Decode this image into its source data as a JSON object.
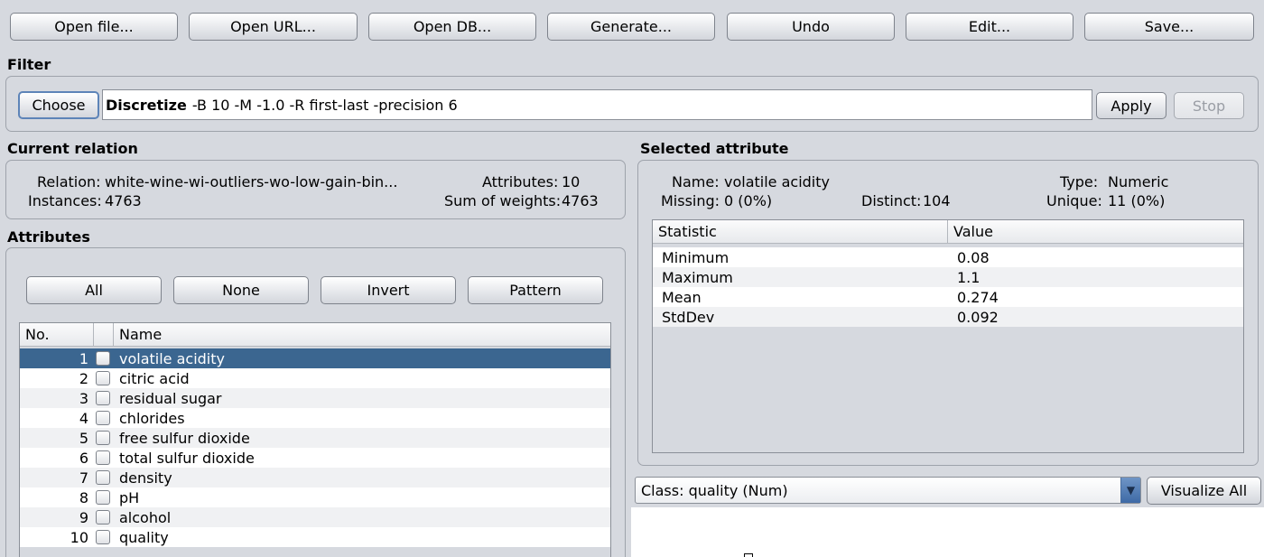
{
  "toolbar": {
    "open_file": "Open file...",
    "open_url": "Open URL...",
    "open_db": "Open DB...",
    "generate": "Generate...",
    "undo": "Undo",
    "edit": "Edit...",
    "save": "Save..."
  },
  "filter": {
    "section_label": "Filter",
    "choose_label": "Choose",
    "filter_name": "Discretize",
    "filter_options": "-B 10 -M -1.0 -R first-last -precision 6",
    "apply_label": "Apply",
    "stop_label": "Stop"
  },
  "current_relation": {
    "section_label": "Current relation",
    "relation_label": "Relation:",
    "relation_value": "white-wine-wi-outliers-wo-low-gain-bin...",
    "instances_label": "Instances:",
    "instances_value": "4763",
    "attributes_label": "Attributes:",
    "attributes_value": "10",
    "sum_weights_label": "Sum of weights:",
    "sum_weights_value": "4763"
  },
  "attributes": {
    "section_label": "Attributes",
    "all_label": "All",
    "none_label": "None",
    "invert_label": "Invert",
    "pattern_label": "Pattern",
    "col_no": "No.",
    "col_name": "Name",
    "rows": [
      {
        "no": "1",
        "name": "volatile acidity"
      },
      {
        "no": "2",
        "name": "citric acid"
      },
      {
        "no": "3",
        "name": "residual sugar"
      },
      {
        "no": "4",
        "name": "chlorides"
      },
      {
        "no": "5",
        "name": "free sulfur dioxide"
      },
      {
        "no": "6",
        "name": "total sulfur dioxide"
      },
      {
        "no": "7",
        "name": "density"
      },
      {
        "no": "8",
        "name": "pH"
      },
      {
        "no": "9",
        "name": "alcohol"
      },
      {
        "no": "10",
        "name": "quality"
      }
    ]
  },
  "selected_attribute": {
    "section_label": "Selected attribute",
    "name_label": "Name:",
    "name_value": "volatile acidity",
    "type_label": "Type:",
    "type_value": "Numeric",
    "missing_label": "Missing:",
    "missing_value": "0 (0%)",
    "distinct_label": "Distinct:",
    "distinct_value": "104",
    "unique_label": "Unique:",
    "unique_value": "11 (0%)",
    "col_statistic": "Statistic",
    "col_value": "Value",
    "stats": [
      {
        "stat": "Minimum",
        "value": "0.08"
      },
      {
        "stat": "Maximum",
        "value": "1.1"
      },
      {
        "stat": "Mean",
        "value": "0.274"
      },
      {
        "stat": "StdDev",
        "value": "0.092"
      }
    ]
  },
  "class_selector": {
    "value": "Class: quality (Num)",
    "visualize_all_label": "Visualize All"
  },
  "colors": {
    "selection": "#3b6690",
    "background": "#d6d9df"
  }
}
